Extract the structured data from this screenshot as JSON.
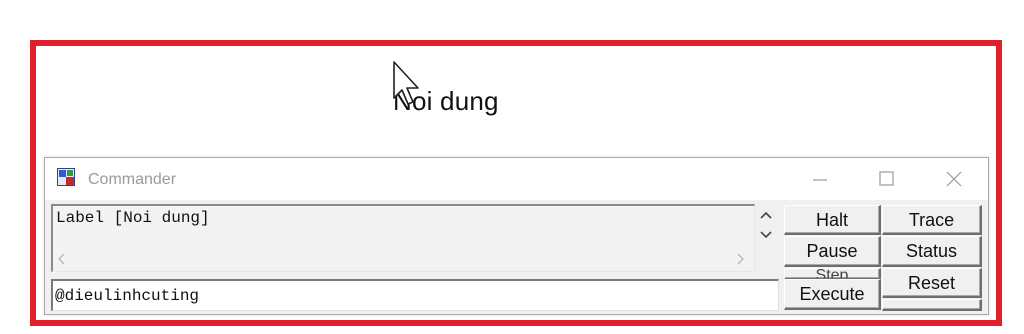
{
  "canvas": {
    "label_text": "Noi dung",
    "frame_color": "#e0212b"
  },
  "window": {
    "title": "Commander",
    "icon": "commander-app-icon",
    "controls": {
      "minimize": "minimize-icon",
      "maximize": "maximize-icon",
      "close": "close-icon"
    }
  },
  "output": {
    "text": "Label [Noi dung]"
  },
  "input": {
    "value": "@dieulinhcuting"
  },
  "buttons": {
    "halt": "Halt",
    "trace": "Trace",
    "pause": "Pause",
    "status": "Status",
    "step": "Step",
    "reset": "Reset",
    "execute": "Execute"
  }
}
